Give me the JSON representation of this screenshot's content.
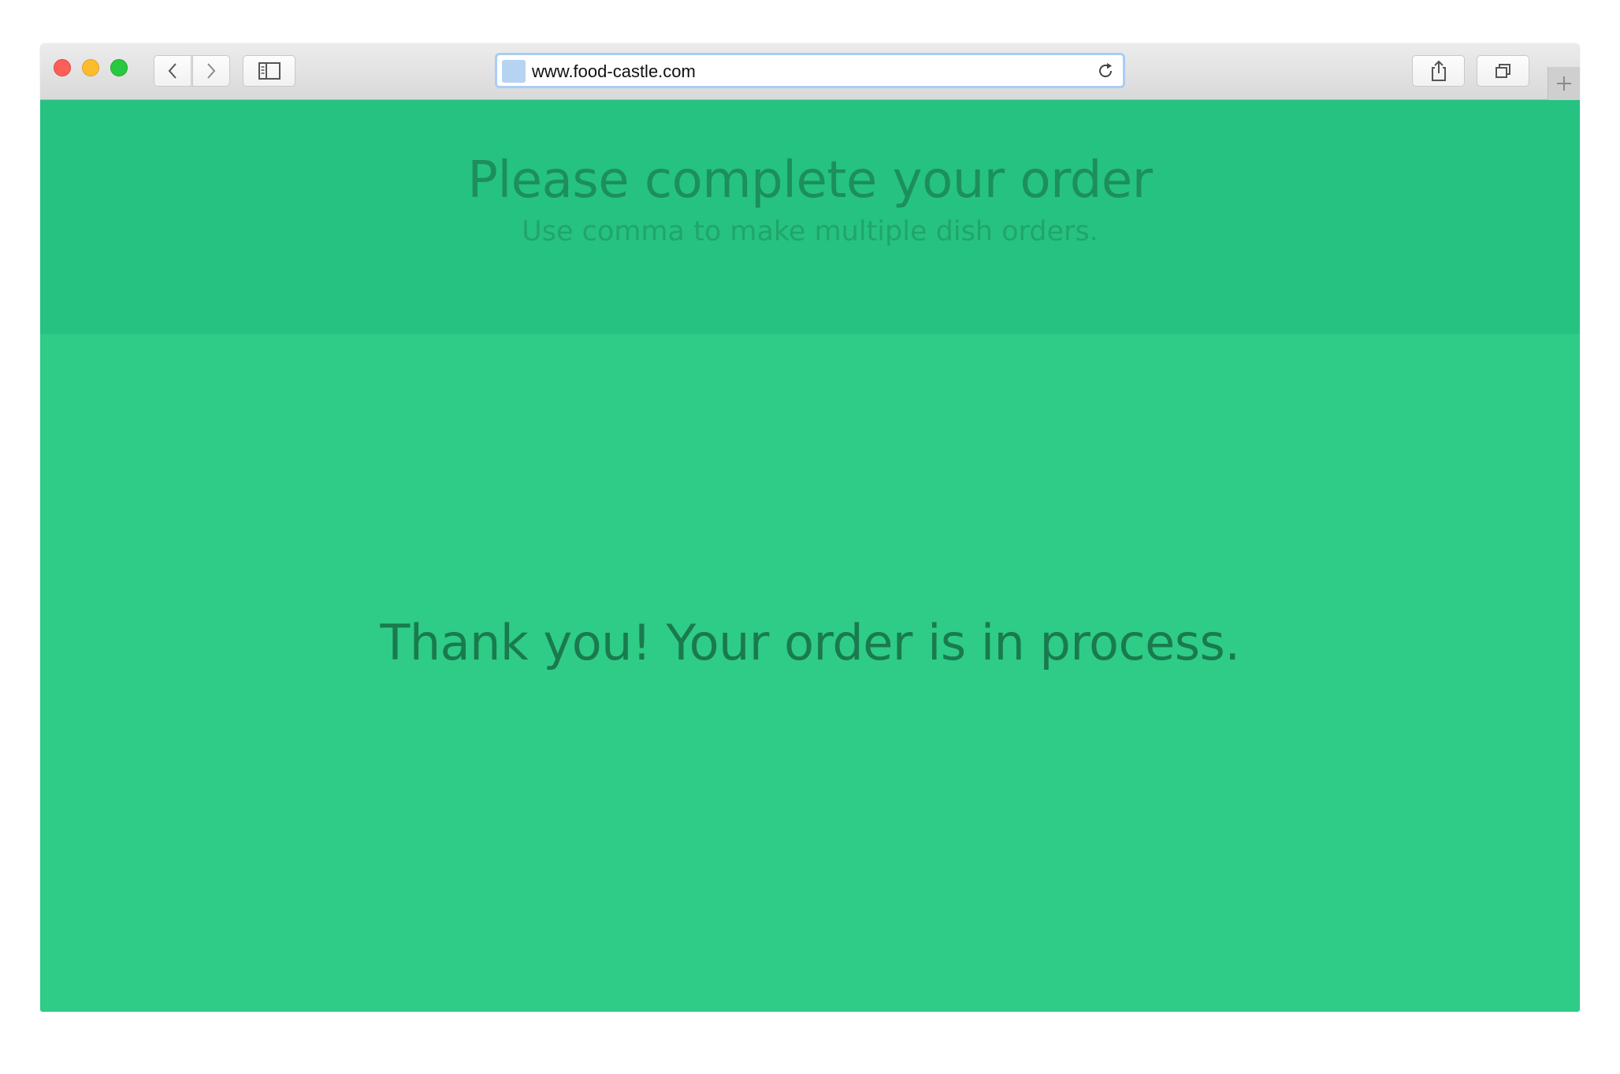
{
  "browser": {
    "url": "www.food-castle.com",
    "icons": {
      "close": "close-window-icon",
      "minimize": "minimize-window-icon",
      "maximize": "zoom-window-icon",
      "back": "chevron-left-icon",
      "forward": "chevron-right-icon",
      "sidebar": "sidebar-icon",
      "reload": "reload-icon",
      "share": "share-icon",
      "tabs": "tab-overview-icon",
      "new_tab": "plus-icon"
    }
  },
  "page": {
    "header": {
      "title": "Please complete your order",
      "subtitle": "Use comma to make multiple dish orders."
    },
    "confirmation": {
      "message": "Thank you! Your order is in process."
    },
    "colors": {
      "header_bg": "#26c281",
      "main_bg": "#2ecc87",
      "title_text": "#1c8f5a",
      "subtitle_text": "#21a56a",
      "message_text": "#1a7a4e"
    }
  }
}
